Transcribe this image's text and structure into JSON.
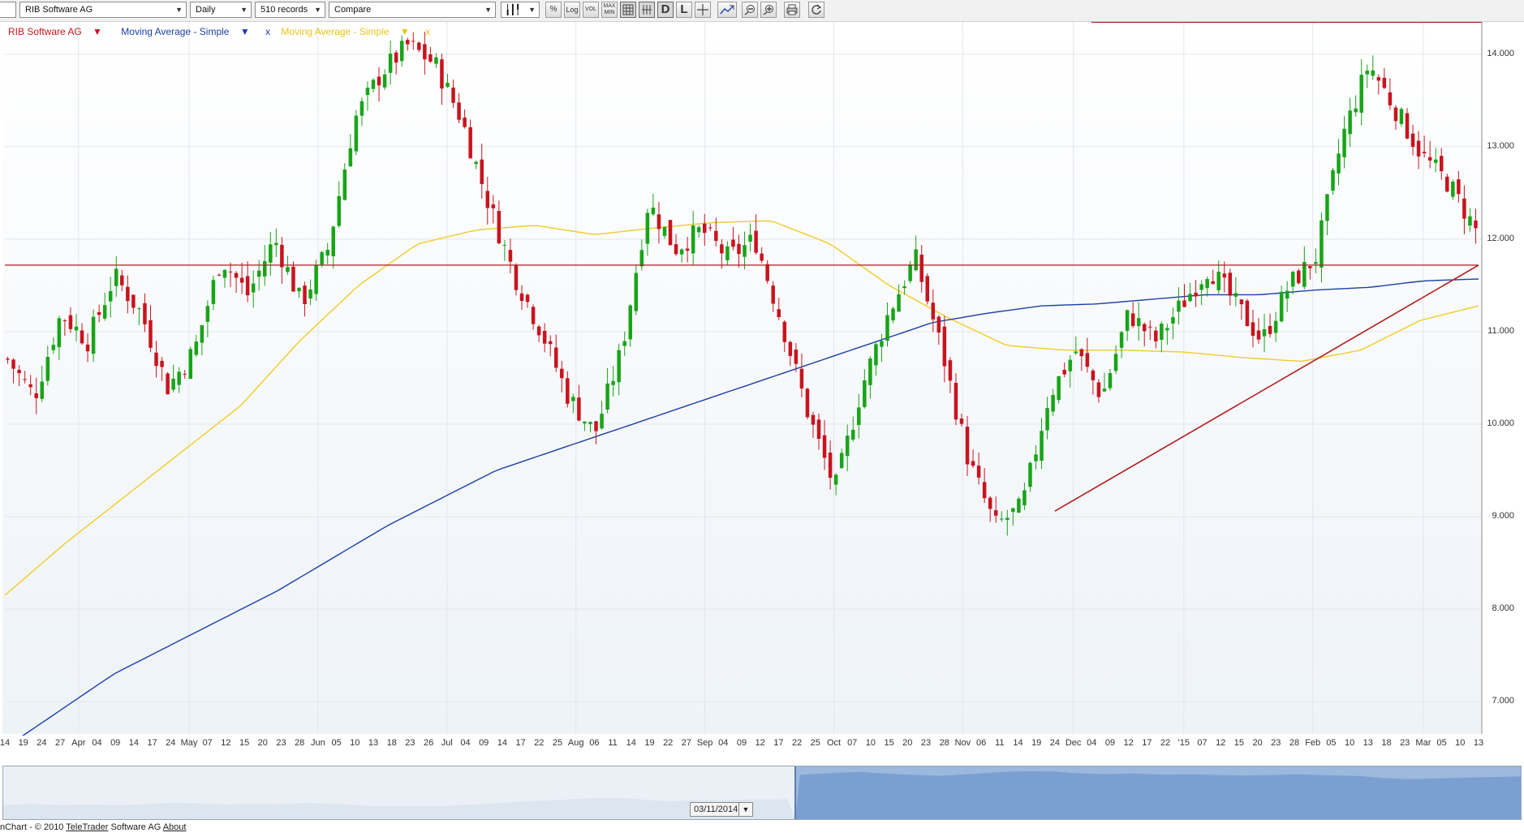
{
  "toolbar": {
    "instrument": "RIB Software AG",
    "interval": "Daily",
    "records": "510 records",
    "compare": "Compare",
    "buttons": {
      "percent": "%",
      "log": "Log",
      "vol": "VOL",
      "maxmin_top": "MAX",
      "maxmin_bottom": "MIN",
      "d": "D",
      "l": "L"
    }
  },
  "legend": {
    "series": "RIB Software AG",
    "ma1": "Moving Average - Simple",
    "ma2": "Moving Average - Simple",
    "remove": "x",
    "down_marker": "▼"
  },
  "colors": {
    "up": "#18a418",
    "down": "#c8141e",
    "ma1": "#1b3fa8",
    "ma2": "#f0cc2a",
    "trend": "#b01e1e",
    "hline": "#b01e1e",
    "grid": "#e3e7ec",
    "nav_fill": "#7a9fd0"
  },
  "chart_data": {
    "type": "candlestick",
    "y_ticks": [
      "14.000",
      "13.000",
      "12.000",
      "11.000",
      "10.000",
      "9.000",
      "8.000",
      "7.000"
    ],
    "x_ticks": [
      "14",
      "19",
      "24",
      "27",
      "Apr",
      "04",
      "09",
      "14",
      "17",
      "24",
      "May",
      "07",
      "12",
      "15",
      "20",
      "23",
      "28",
      "Jun",
      "05",
      "10",
      "13",
      "18",
      "23",
      "26",
      "Jul",
      "04",
      "09",
      "14",
      "17",
      "22",
      "25",
      "Aug",
      "06",
      "11",
      "14",
      "19",
      "22",
      "27",
      "Sep",
      "04",
      "09",
      "12",
      "17",
      "22",
      "25",
      "Oct",
      "07",
      "10",
      "15",
      "20",
      "23",
      "28",
      "Nov",
      "06",
      "11",
      "14",
      "19",
      "24",
      "Dec",
      "04",
      "09",
      "12",
      "17",
      "22",
      "'15",
      "07",
      "12",
      "15",
      "20",
      "23",
      "28",
      "Feb",
      "05",
      "10",
      "13",
      "18",
      "23",
      "Mar",
      "05",
      "10",
      "13"
    ],
    "ylim": [
      6.65,
      14.35
    ],
    "horizontal_line": 11.72,
    "trend_line": {
      "from": [
        "Nov 24",
        9.06
      ],
      "to": [
        "Mar 13",
        11.72
      ]
    },
    "price_keypoints": [
      10.7,
      10.3,
      11.2,
      10.9,
      11.6,
      11.2,
      10.4,
      10.8,
      11.8,
      11.4,
      12.0,
      11.3,
      11.9,
      13.3,
      13.8,
      14.1,
      13.9,
      13.3,
      12.4,
      11.6,
      11.0,
      10.3,
      9.9,
      10.8,
      12.4,
      11.9,
      12.1,
      11.8,
      12.0,
      11.1,
      10.1,
      9.3,
      10.4,
      11.2,
      11.8,
      10.8,
      9.6,
      8.9,
      9.1,
      10.3,
      10.8,
      10.3,
      11.2,
      10.9,
      11.3,
      11.7,
      11.3,
      10.9,
      11.5,
      11.8,
      13.1,
      13.9,
      13.4,
      12.9,
      12.6,
      12.1
    ],
    "ma1_keypoints": [
      6.5,
      6.9,
      7.3,
      7.6,
      7.9,
      8.2,
      8.55,
      8.9,
      9.2,
      9.5,
      9.7,
      9.9,
      10.1,
      10.3,
      10.5,
      10.7,
      10.9,
      11.1,
      11.2,
      11.28,
      11.3,
      11.35,
      11.4,
      11.4,
      11.45,
      11.48,
      11.55,
      11.57
    ],
    "ma2_keypoints": [
      8.15,
      8.7,
      9.2,
      9.7,
      10.2,
      10.9,
      11.5,
      11.95,
      12.1,
      12.15,
      12.05,
      12.12,
      12.18,
      12.2,
      11.95,
      11.5,
      11.15,
      10.85,
      10.8,
      10.8,
      10.78,
      10.72,
      10.68,
      10.8,
      11.12,
      11.28
    ]
  },
  "navigator": {
    "date": "03/11/2014"
  },
  "footer": {
    "prefix": "nChart - © 2010 ",
    "company": "TeleTrader",
    "middle": " Software AG ",
    "about": "About"
  }
}
